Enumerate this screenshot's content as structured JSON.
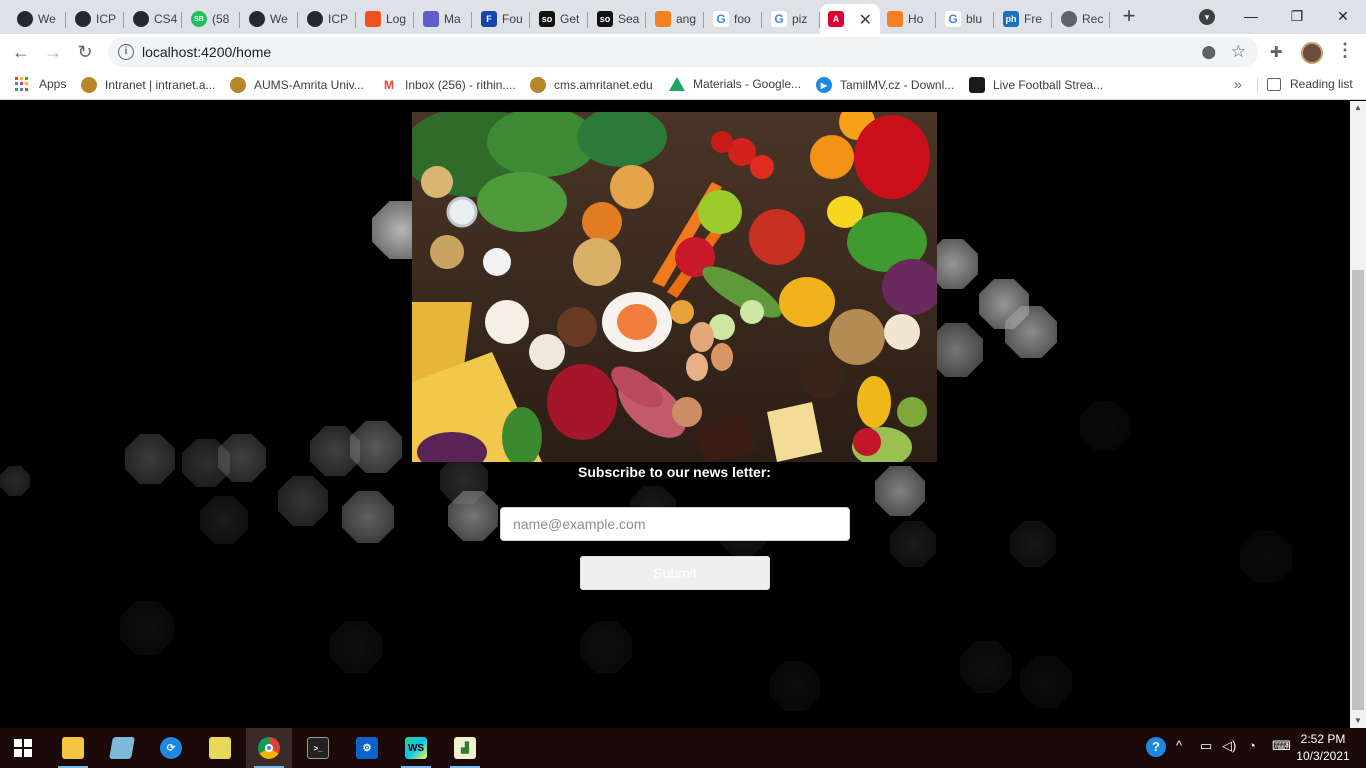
{
  "browser": {
    "tabs": [
      {
        "label": "We",
        "icon": "github-icon",
        "color": "#24292e"
      },
      {
        "label": "ICP",
        "icon": "github-icon",
        "color": "#24292e"
      },
      {
        "label": "CS4",
        "icon": "github-icon",
        "color": "#24292e"
      },
      {
        "label": "(58",
        "icon": "sb-icon",
        "color": "#1fc15b"
      },
      {
        "label": "We",
        "icon": "github-icon",
        "color": "#24292e"
      },
      {
        "label": "ICP",
        "icon": "github-icon",
        "color": "#24292e"
      },
      {
        "label": "Log",
        "icon": "microsoft-icon",
        "color": "#f25022"
      },
      {
        "label": "Ma",
        "icon": "teams-icon",
        "color": "#5b5fc7"
      },
      {
        "label": "Fou",
        "icon": "f-icon",
        "color": "#1646a8"
      },
      {
        "label": "Get",
        "icon": "stackoverflow-icon",
        "color": "#111111"
      },
      {
        "label": "Sea",
        "icon": "stackoverflow-icon",
        "color": "#111111"
      },
      {
        "label": "ang",
        "icon": "stack-icon",
        "color": "#f48024"
      },
      {
        "label": "foo",
        "icon": "google-icon",
        "color": "#4285f4"
      },
      {
        "label": "piz",
        "icon": "google-icon",
        "color": "#4285f4"
      },
      {
        "label": "",
        "icon": "angular-icon",
        "color": "#dd0031",
        "active": true
      },
      {
        "label": "Ho",
        "icon": "stack-icon",
        "color": "#f48024"
      },
      {
        "label": "blu",
        "icon": "google-icon",
        "color": "#4285f4"
      },
      {
        "label": "Fre",
        "icon": "ph-icon",
        "color": "#1d6fbf"
      },
      {
        "label": "Rec",
        "icon": "globe-icon",
        "color": "#5f6368"
      }
    ],
    "url": "localhost:4200/home",
    "bookmarks": [
      {
        "label": "Apps",
        "icon": "apps-grid-icon"
      },
      {
        "label": "Intranet | intranet.a...",
        "icon": "amrita-icon",
        "color": "#b8862b"
      },
      {
        "label": "AUMS-Amrita Univ...",
        "icon": "amrita-icon",
        "color": "#b8862b"
      },
      {
        "label": "Inbox (256) - rithin....",
        "icon": "gmail-icon",
        "color": "#ea4335"
      },
      {
        "label": "cms.amritanet.edu",
        "icon": "amrita-icon",
        "color": "#b8862b"
      },
      {
        "label": "Materials - Google...",
        "icon": "drive-icon",
        "color": "#1fa463"
      },
      {
        "label": "TamilMV.cz - Downl...",
        "icon": "play-icon",
        "color": "#1e88e5"
      },
      {
        "label": "Live Football Strea...",
        "icon": "football-icon",
        "color": "#1a1a1a"
      }
    ],
    "reading_list": "Reading list"
  },
  "page": {
    "hero_alt": "",
    "subscribe_heading": "Subscribe to our news letter:",
    "email_placeholder": "name@example.com",
    "submit_label": "Submit"
  },
  "taskbar": {
    "time": "2:52 PM",
    "date": "10/3/2021"
  }
}
